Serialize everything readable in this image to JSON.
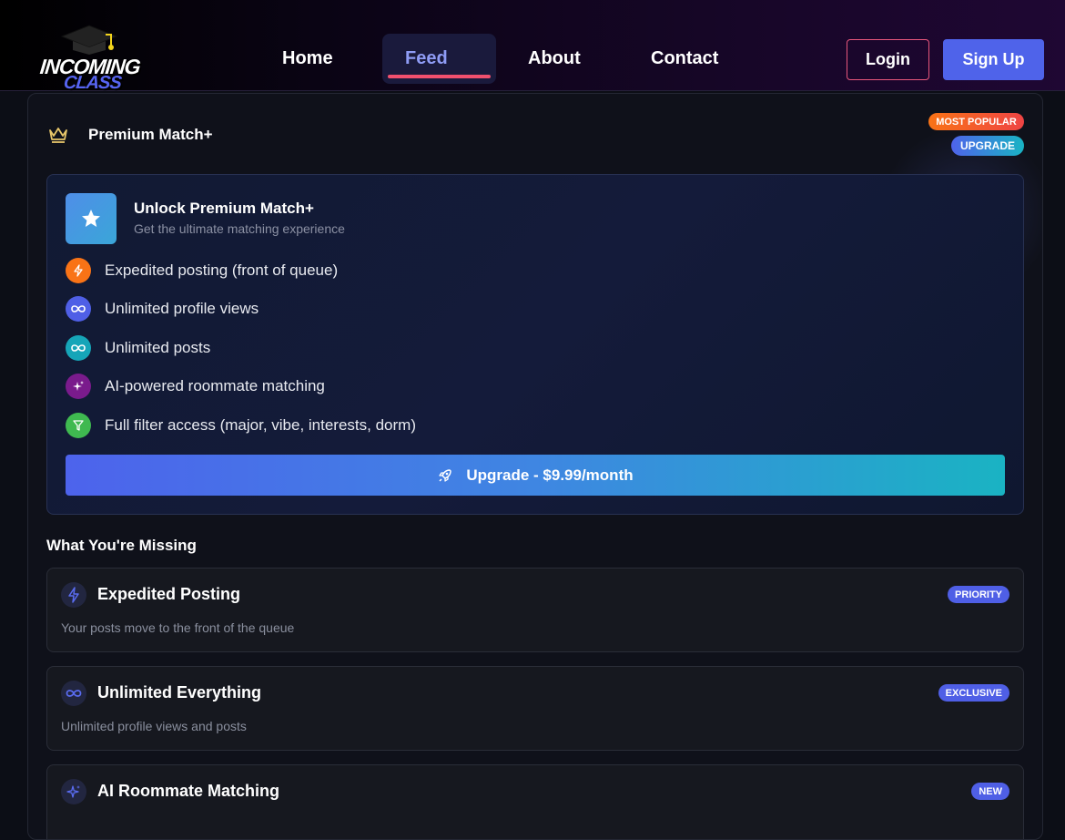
{
  "logo": {
    "line1": "INCOMING",
    "line2": "CLASS"
  },
  "nav": {
    "items": [
      {
        "label": "Home"
      },
      {
        "label": "Feed",
        "active": true
      },
      {
        "label": "About"
      },
      {
        "label": "Contact"
      }
    ],
    "login_label": "Login",
    "signup_label": "Sign Up"
  },
  "panel": {
    "title": "Premium Match+",
    "badge_popular": "MOST POPULAR",
    "badge_upgrade": "UPGRADE"
  },
  "premium_card": {
    "title": "Unlock Premium Match+",
    "subtitle": "Get the ultimate matching experience",
    "features": [
      {
        "icon": "bolt-icon",
        "color": "#f97316",
        "label": "Expedited posting (front of queue)"
      },
      {
        "icon": "infinity-icon",
        "color": "#4f5fe6",
        "label": "Unlimited profile views"
      },
      {
        "icon": "infinity-icon",
        "color": "#16a5b8",
        "label": "Unlimited posts"
      },
      {
        "icon": "sparkles-icon",
        "color": "#7a1b8c",
        "label": "AI-powered roommate matching"
      },
      {
        "icon": "filter-icon",
        "color": "#3fb950",
        "label": "Full filter access (major, vibe, interests, dorm)"
      }
    ],
    "upgrade_label": "Upgrade - $9.99/month"
  },
  "missing": {
    "title": "What You're Missing",
    "items": [
      {
        "icon": "bolt-icon",
        "title": "Expedited Posting",
        "description": "Your posts move to the front of the queue",
        "badge": "PRIORITY"
      },
      {
        "icon": "infinity-icon",
        "title": "Unlimited Everything",
        "description": "Unlimited profile views and posts",
        "badge": "EXCLUSIVE"
      },
      {
        "icon": "sparkles-icon",
        "title": "AI Roommate Matching",
        "description": "",
        "badge": "NEW"
      }
    ]
  },
  "colors": {
    "accent": "#4f63ea",
    "login_border": "#e8577c",
    "active_underline": "#f0506e",
    "crown": "#e7c66a"
  }
}
